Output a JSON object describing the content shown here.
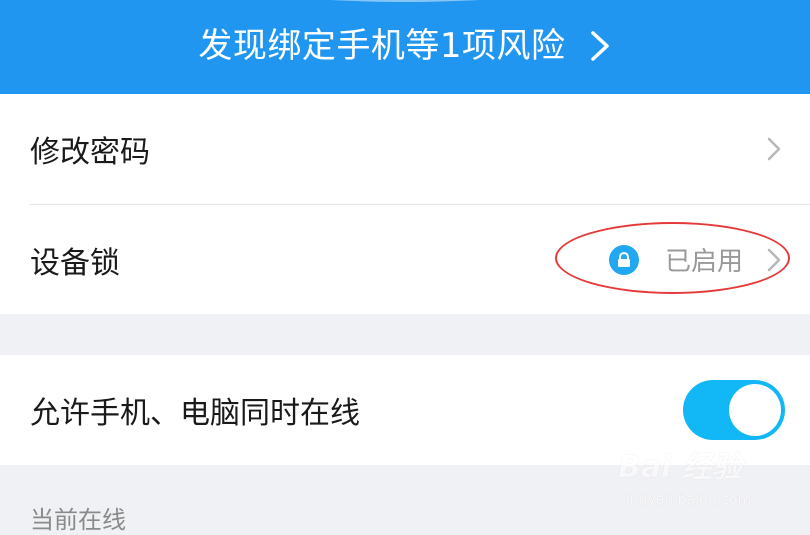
{
  "banner": {
    "risk_text": "发现绑定手机等1项风险",
    "chevron_icon": "chevron-right-icon"
  },
  "security": {
    "change_password_label": "修改密码",
    "device_lock_label": "设备锁",
    "device_lock_status": "已启用",
    "lock_icon": "lock-icon"
  },
  "online": {
    "allow_both_online_label": "允许手机、电脑同时在线",
    "allow_both_online_enabled": true,
    "current_online_header": "当前在线"
  },
  "watermark": {
    "brand": "Bai 经验",
    "url": "jingyan.baidu.com"
  },
  "colors": {
    "banner_blue": "#2196f0",
    "toggle_on": "#12b7f5",
    "lock_badge": "#21a8f0",
    "annotation_red": "#e53a3a"
  }
}
